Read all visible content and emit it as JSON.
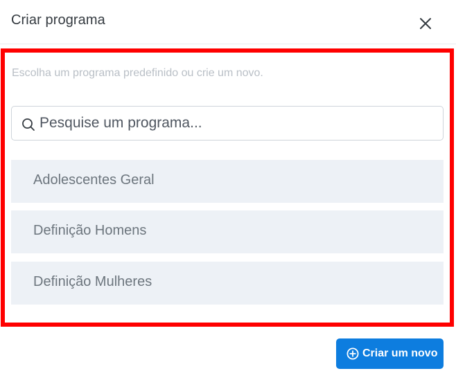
{
  "modal": {
    "title": "Criar programa",
    "close_icon": "close-icon"
  },
  "body": {
    "subtitle": "Escolha um programa predefinido ou crie um novo.",
    "search": {
      "placeholder": "Pesquise um programa...",
      "value": "",
      "icon": "search-icon"
    },
    "programs": [
      {
        "label": "Adolescentes Geral"
      },
      {
        "label": "Definição Homens"
      },
      {
        "label": "Definição Mulheres"
      }
    ]
  },
  "footer": {
    "create_button_label": "Criar um novo",
    "create_button_icon": "plus-circle-icon"
  },
  "colors": {
    "highlight_border": "#ff0000",
    "primary_button": "#0d7ddf",
    "list_item_bg": "#edf1f6"
  }
}
